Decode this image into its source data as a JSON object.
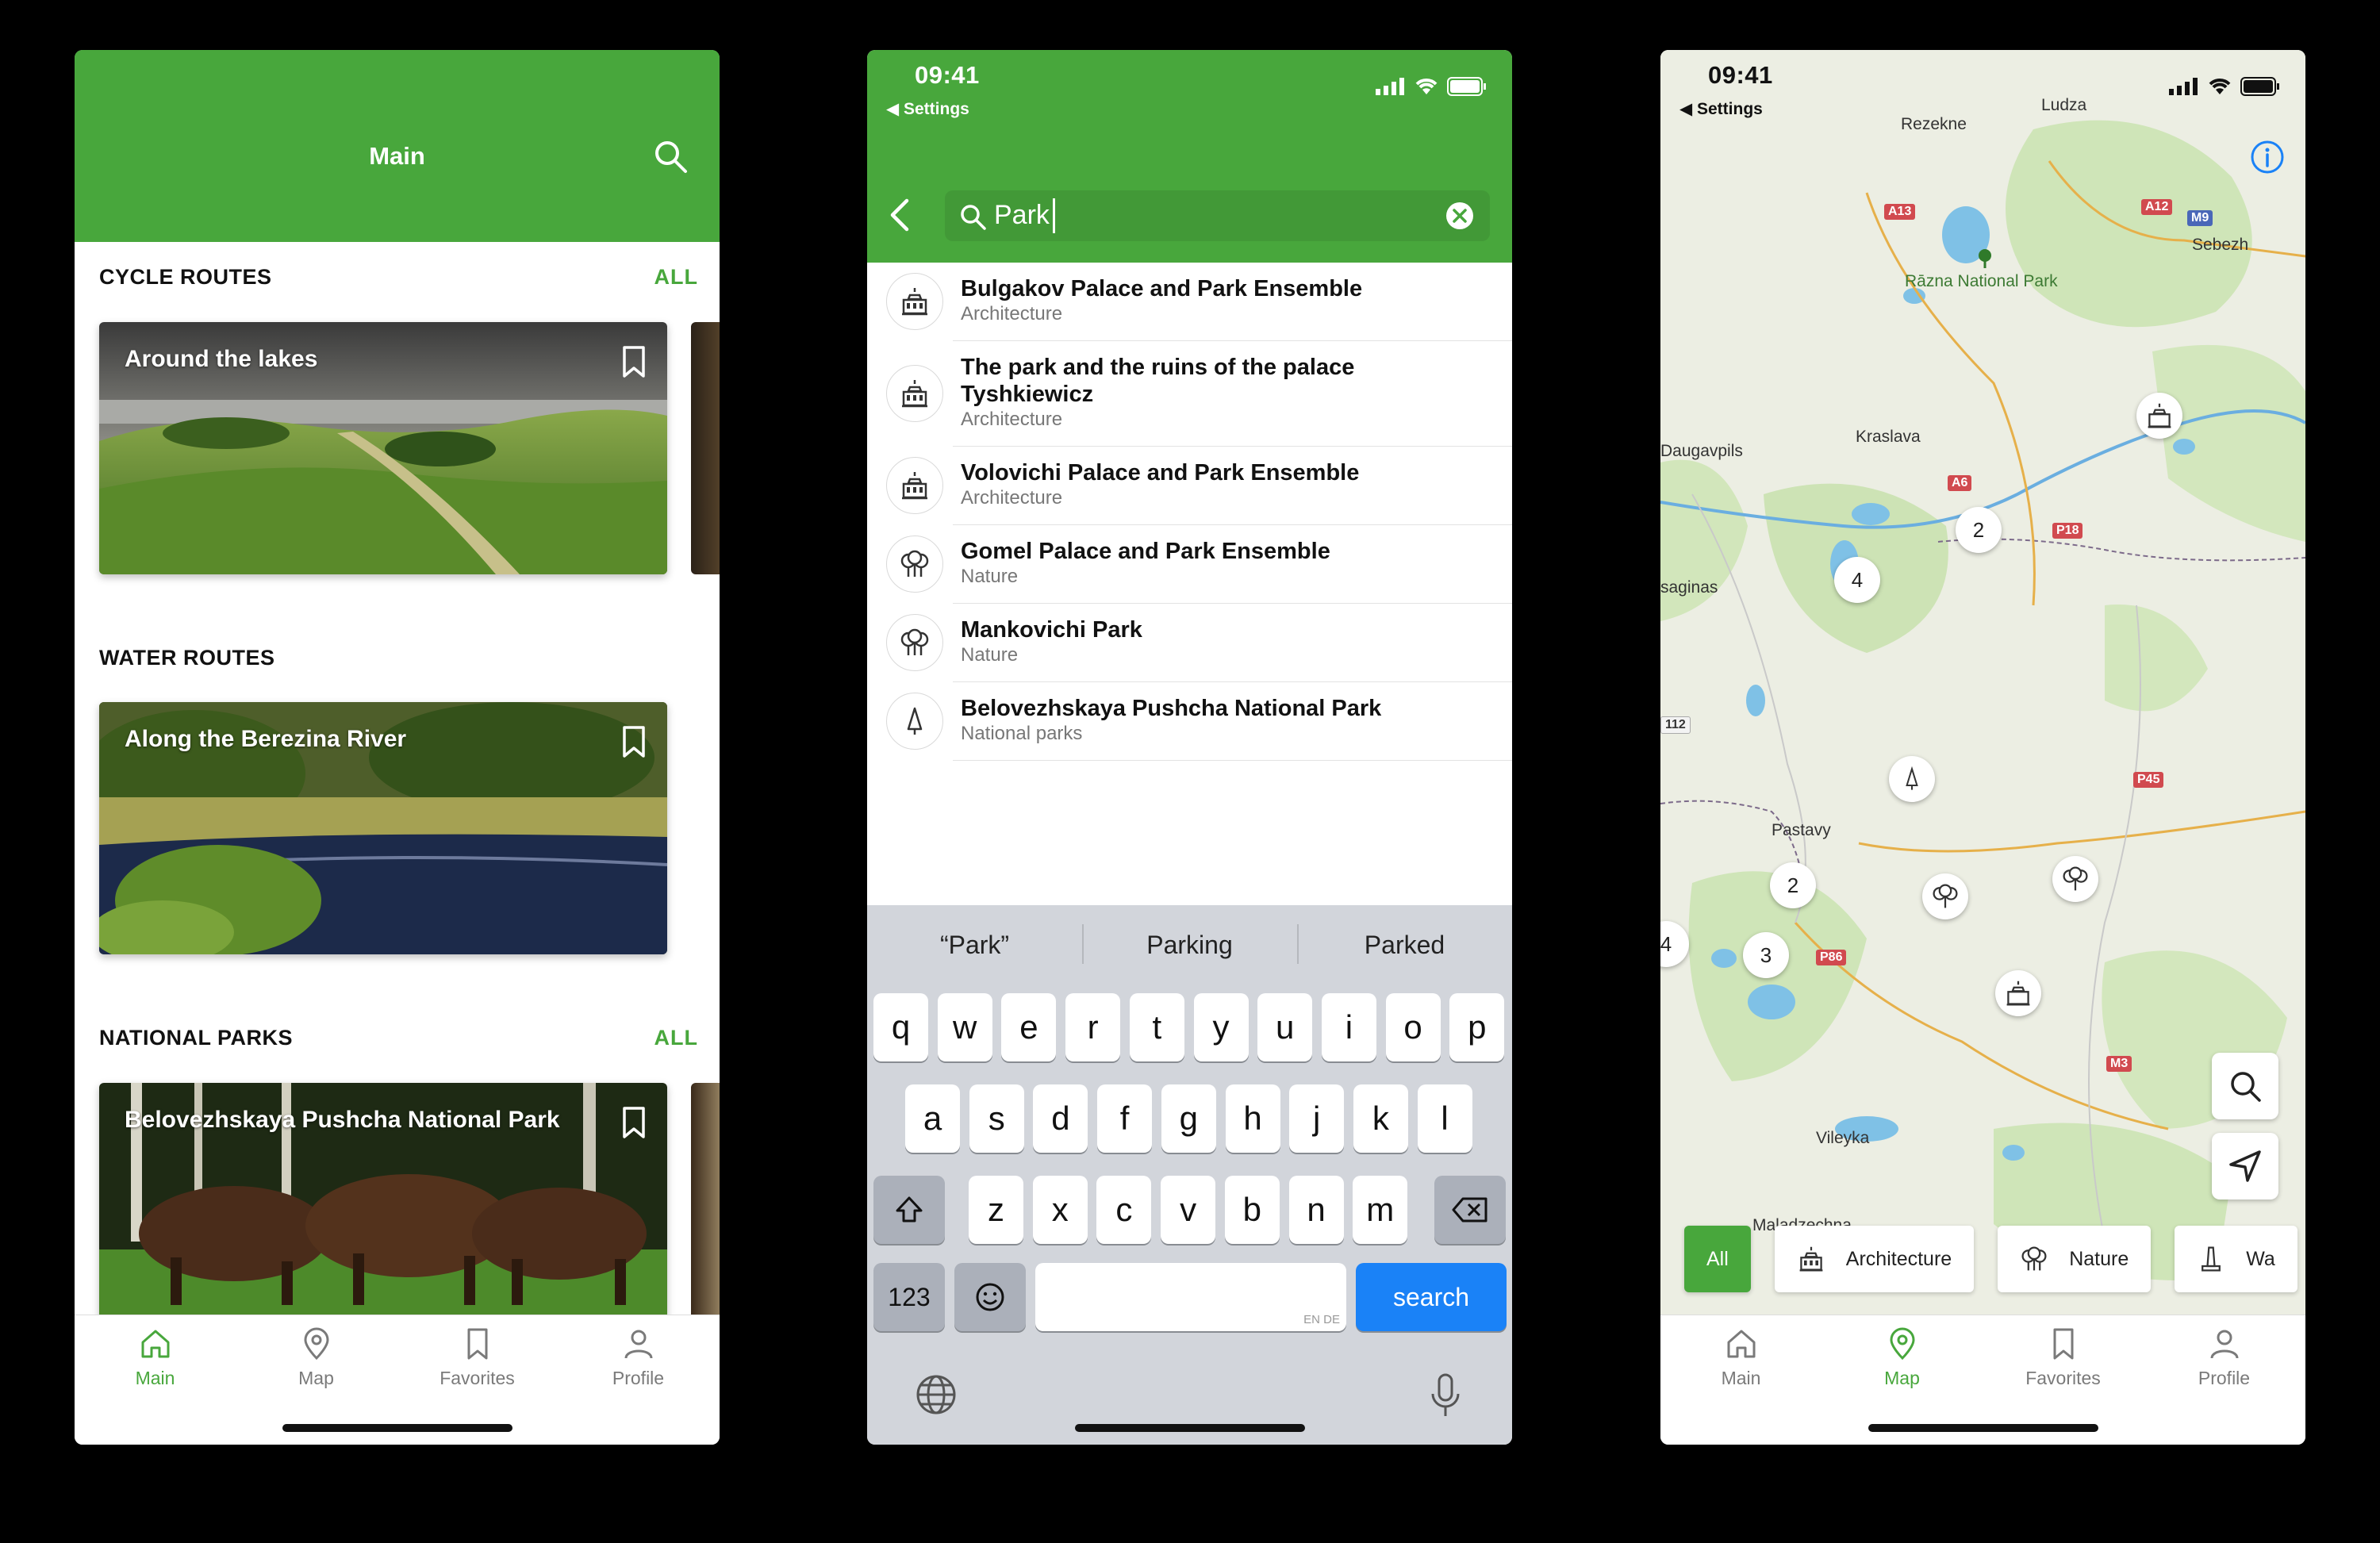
{
  "status": {
    "time": "09:41",
    "back_app": "◀ Settings"
  },
  "main_screen": {
    "title": "Main",
    "sections": [
      {
        "title": "CYCLE ROUTES",
        "all": "ALL",
        "card_title": "Around the lakes"
      },
      {
        "title": "WATER ROUTES",
        "all": "",
        "card_title": "Along the Berezina River"
      },
      {
        "title": "NATIONAL PARKS",
        "all": "ALL",
        "card_title": "Belovezhskaya Pushcha National Park"
      }
    ]
  },
  "tabs": [
    {
      "label": "Main",
      "icon": "home-icon"
    },
    {
      "label": "Map",
      "icon": "map-pin-icon"
    },
    {
      "label": "Favorites",
      "icon": "bookmark-icon"
    },
    {
      "label": "Profile",
      "icon": "person-icon"
    }
  ],
  "search_screen": {
    "query": "Park",
    "results": [
      {
        "title": "Bulgakov Palace and Park Ensemble",
        "category": "Architecture",
        "icon": "building-icon"
      },
      {
        "title": "The park and the ruins of the palace Tyshkiewicz",
        "category": "Architecture",
        "icon": "building-icon"
      },
      {
        "title": "Volovichi Palace and Park Ensemble",
        "category": "Architecture",
        "icon": "building-icon"
      },
      {
        "title": "Gomel Palace and Park Ensemble",
        "category": "Nature",
        "icon": "trees-icon"
      },
      {
        "title": "Mankovichi Park",
        "category": "Nature",
        "icon": "trees-icon"
      },
      {
        "title": "Belovezhskaya Pushcha National Park",
        "category": "National parks",
        "icon": "pine-tree-icon"
      }
    ],
    "keyboard": {
      "suggestions": [
        "“Park”",
        "Parking",
        "Parked"
      ],
      "row1": [
        "q",
        "w",
        "e",
        "r",
        "t",
        "y",
        "u",
        "i",
        "o",
        "p"
      ],
      "row2": [
        "a",
        "s",
        "d",
        "f",
        "g",
        "h",
        "j",
        "k",
        "l"
      ],
      "row3": [
        "z",
        "x",
        "c",
        "v",
        "b",
        "n",
        "m"
      ],
      "numbers_key": "123",
      "space_hint": "EN DE",
      "search_key": "search"
    }
  },
  "map_screen": {
    "labels": {
      "rezekne": "Rezekne",
      "ludza": "Ludza",
      "sebezh": "Sebezh",
      "razna": "Rāzna National Park",
      "kraslava": "Kraslava",
      "daugavpils": "Daugavpils",
      "saginas": "saginas",
      "pastavy": "Pastavy",
      "vileyka": "Vileyka",
      "maladzechna": "Maladzechna"
    },
    "roads": {
      "a13": "A13",
      "a12": "A12",
      "m9": "M9",
      "a6": "A6",
      "p18": "P18",
      "p45": "P45",
      "p86": "P86",
      "m3": "M3",
      "r112": "112"
    },
    "clusters": {
      "c1": "2",
      "c2": "4",
      "c3": "2",
      "c4": "3",
      "c5": "4"
    },
    "filters": [
      {
        "label": "All",
        "icon": ""
      },
      {
        "label": "Architecture",
        "icon": "building-icon"
      },
      {
        "label": "Nature",
        "icon": "trees-icon"
      },
      {
        "label": "Wa",
        "icon": "monument-icon"
      }
    ]
  },
  "colors": {
    "accent": "#48a73c",
    "keyboard_bg": "#d2d5db",
    "search_key": "#1a82f7",
    "road": "#d14a4f"
  }
}
